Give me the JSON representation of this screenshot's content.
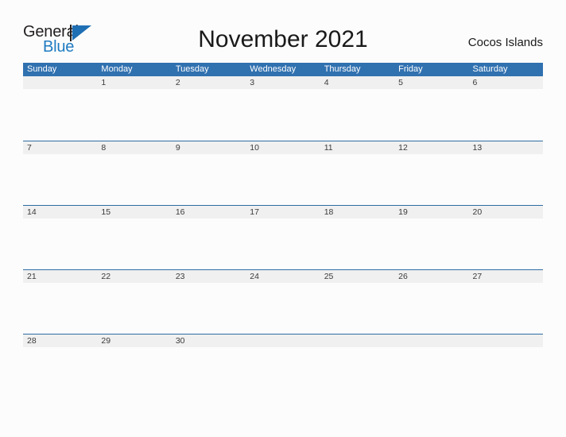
{
  "brand": {
    "name_part1": "General",
    "name_part2": "Blue",
    "logo_icon": "triangle-flag-icon",
    "color_dark": "#231f20",
    "color_blue": "#1f7bc1"
  },
  "header": {
    "title": "November 2021",
    "region": "Cocos Islands"
  },
  "theme": {
    "header_blue": "#3071b0",
    "row_divider_blue": "#2e6da4",
    "band_gray": "#f0f0f0",
    "page_background": "#fcfcfc",
    "date_text": "#3a3a3a"
  },
  "calendar": {
    "month": "November",
    "year": "2021",
    "weekday_headers": [
      "Sunday",
      "Monday",
      "Tuesday",
      "Wednesday",
      "Thursday",
      "Friday",
      "Saturday"
    ],
    "weeks": [
      [
        "",
        "1",
        "2",
        "3",
        "4",
        "5",
        "6"
      ],
      [
        "7",
        "8",
        "9",
        "10",
        "11",
        "12",
        "13"
      ],
      [
        "14",
        "15",
        "16",
        "17",
        "18",
        "19",
        "20"
      ],
      [
        "21",
        "22",
        "23",
        "24",
        "25",
        "26",
        "27"
      ],
      [
        "28",
        "29",
        "30",
        "",
        "",
        "",
        ""
      ]
    ]
  }
}
